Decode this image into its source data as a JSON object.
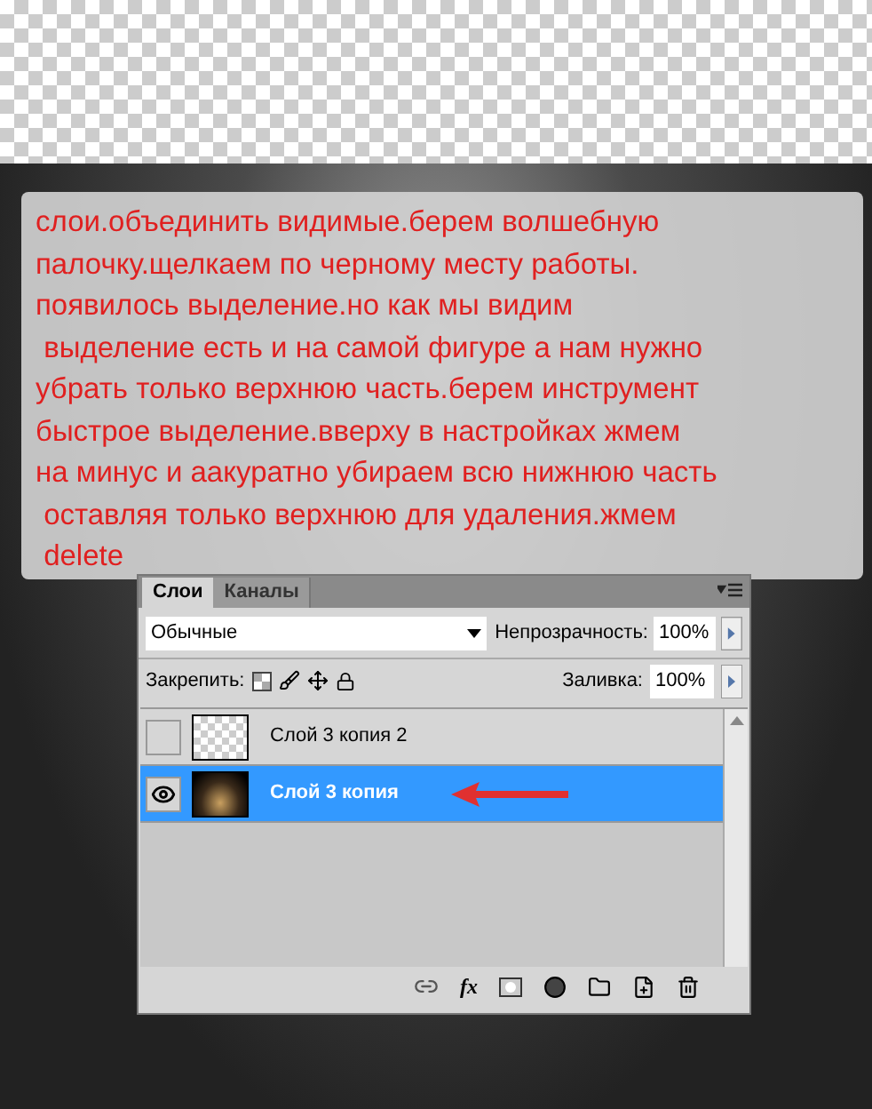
{
  "note": {
    "lines": [
      "слои.объединить видимые.берем волшебную",
      "палочку.щелкаем по черному месту работы.",
      "появилось выделение.но как мы видим",
      " выделение есть и на самой фигуре а нам нужно",
      "убрать только верхнюю часть.берем инструмент",
      "быстрое выделение.вверху в настройках жмем",
      "на минус и аакуратно убираем всю нижнюю часть",
      " оставляя только верхнюю для удаления.жмем",
      " delete"
    ]
  },
  "tabs": [
    {
      "label": "Слои",
      "selected": true
    },
    {
      "label": "Каналы",
      "selected": false
    }
  ],
  "blend_mode": "Обычные",
  "opacity": {
    "label": "Непрозрачность:",
    "value": "100%"
  },
  "lock": {
    "label": "Закрепить:"
  },
  "fill": {
    "label": "Заливка:",
    "value": "100%"
  },
  "effects_button": {
    "glyph": "fx"
  },
  "layers": [
    {
      "name": "Слой 3 копия 2",
      "visible": false,
      "selected": false,
      "kind": "empty",
      "arrow": false
    },
    {
      "name": "Слой 3 копия",
      "visible": true,
      "selected": true,
      "kind": "image",
      "arrow": true
    }
  ]
}
